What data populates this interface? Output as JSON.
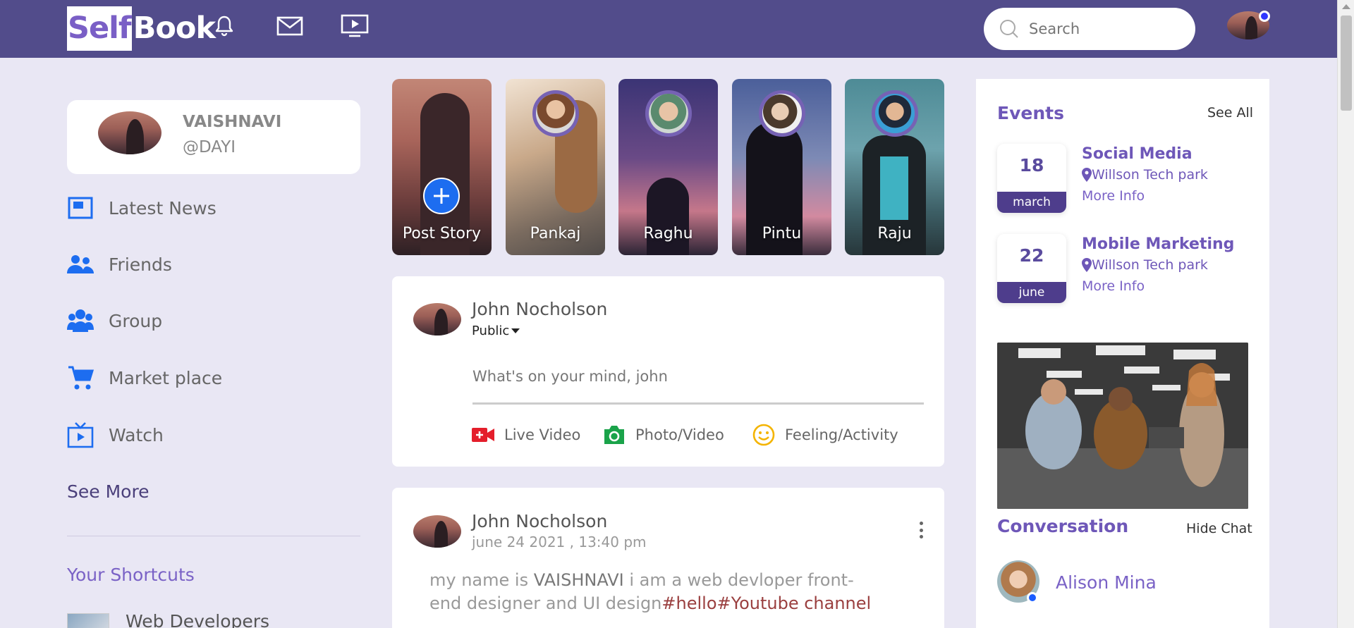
{
  "header": {
    "logo_part1": "Self",
    "logo_part2": "Book",
    "search_placeholder": "Search"
  },
  "profile": {
    "name": "VAISHNAVI",
    "handle": "@DAYI"
  },
  "nav": {
    "items": [
      {
        "label": "Latest News",
        "icon": "news-icon"
      },
      {
        "label": "Friends",
        "icon": "friends-icon"
      },
      {
        "label": "Group",
        "icon": "group-icon"
      },
      {
        "label": "Market place",
        "icon": "cart-icon"
      },
      {
        "label": "Watch",
        "icon": "watch-icon"
      }
    ],
    "see_more": "See More"
  },
  "shortcuts": {
    "title": "Your Shortcuts",
    "items": [
      {
        "label": "Web Developers"
      }
    ]
  },
  "stories": [
    {
      "name": "Post Story"
    },
    {
      "name": "Pankaj"
    },
    {
      "name": "Raghu"
    },
    {
      "name": "Pintu"
    },
    {
      "name": "Raju"
    }
  ],
  "create_post": {
    "author": "John Nocholson",
    "privacy": "Public",
    "placeholder": "What's on your mind, john",
    "actions": [
      {
        "label": "Live Video",
        "icon": "live-video-icon",
        "color": "#e41e2b"
      },
      {
        "label": "Photo/Video",
        "icon": "camera-icon",
        "color": "#1aa34a"
      },
      {
        "label": "Feeling/Activity",
        "icon": "smile-icon",
        "color": "#f4b400"
      }
    ]
  },
  "feed_post": {
    "author": "John Nocholson",
    "time": "june 24 2021 , 13:40 pm",
    "text_pre": "my name is ",
    "text_name": "VAISHNAVI",
    "text_mid": " i am a web devloper front-end designer and UI design",
    "text_tags": "#hello#Youtube channel"
  },
  "events": {
    "title": "Events",
    "see_all": "See All",
    "items": [
      {
        "day": "18",
        "month": "march",
        "title": "Social Media",
        "location": "Willson Tech park",
        "more": "More Info"
      },
      {
        "day": "22",
        "month": "june",
        "title": "Mobile Marketing",
        "location": "Willson Tech park",
        "more": "More Info"
      }
    ]
  },
  "conversation": {
    "title": "Conversation",
    "hide": "Hide Chat",
    "contacts": [
      {
        "name": "Alison Mina"
      }
    ]
  },
  "colors": {
    "header": "#524c8b",
    "accent": "#6e57b8",
    "background": "#e9e7f4",
    "brand_blue": "#1d6df0"
  }
}
